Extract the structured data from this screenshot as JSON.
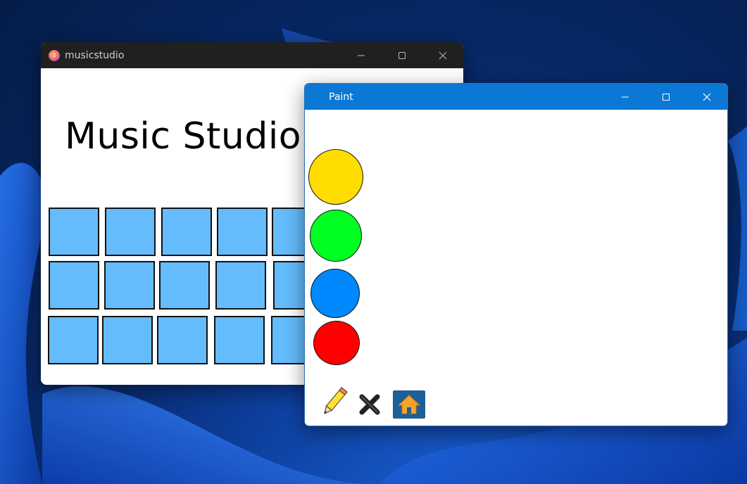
{
  "music_window": {
    "title": "musicstudio",
    "heading": "Music Studio!",
    "pad_color": "#64bcfc",
    "pad_rows": 3,
    "pad_cols_visible": 5
  },
  "paint_window": {
    "title": "Paint",
    "colors": [
      {
        "name": "yellow",
        "hex": "#ffdd00"
      },
      {
        "name": "green",
        "hex": "#00ff22"
      },
      {
        "name": "blue",
        "hex": "#0088ff"
      },
      {
        "name": "red",
        "hex": "#ff0000"
      }
    ],
    "tools": [
      "pencil-icon",
      "clear-icon",
      "home-icon"
    ]
  },
  "titlebar_dark": "#202020",
  "titlebar_accent": "#0a78d4"
}
